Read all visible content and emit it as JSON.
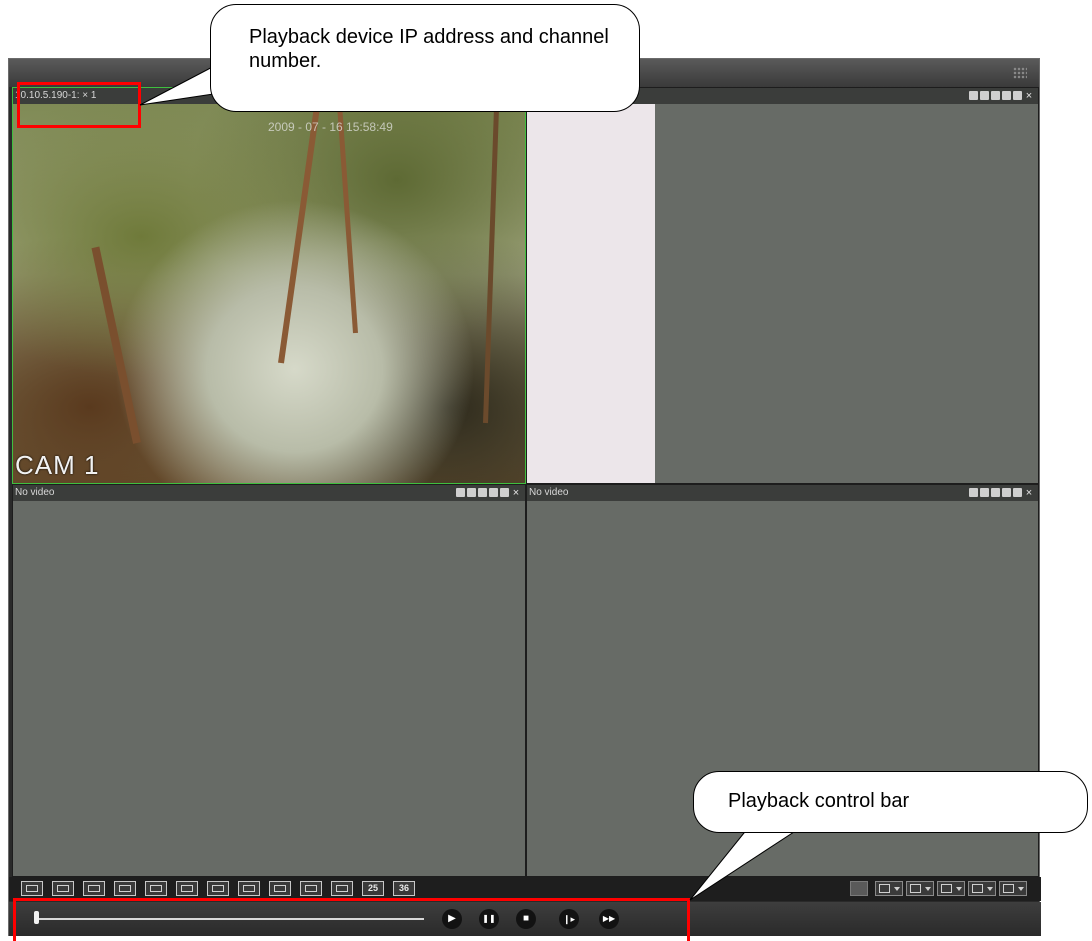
{
  "window": {
    "panes": [
      {
        "title": "10.10.5.190-1: × 1",
        "overlay_label": "CAM 1",
        "timestamp": "2009 - 07 - 16 15:58:49",
        "active": true
      },
      {
        "title": "",
        "overlay_label": "",
        "timestamp": "",
        "active": false
      },
      {
        "title": "No video",
        "overlay_label": "",
        "timestamp": "",
        "active": false
      },
      {
        "title": "No video",
        "overlay_label": "",
        "timestamp": "",
        "active": false
      }
    ],
    "pane_tool_icons": [
      "window-snapshot-icon",
      "record-icon",
      "pip-icon",
      "camera-icon",
      "audio-icon",
      "close-icon"
    ],
    "layout_buttons": [
      {
        "icon": "layout-custom-icon",
        "label": ""
      },
      {
        "icon": "layout-next-icon",
        "label": ""
      },
      {
        "icon": "fullscreen-icon",
        "label": ""
      },
      {
        "icon": "layout-1-icon",
        "label": ""
      },
      {
        "icon": "layout-4-icon",
        "label": ""
      },
      {
        "icon": "layout-6-icon",
        "label": ""
      },
      {
        "icon": "layout-8-icon",
        "label": ""
      },
      {
        "icon": "layout-9-icon",
        "label": ""
      },
      {
        "icon": "layout-13-icon",
        "label": ""
      },
      {
        "icon": "layout-16-icon",
        "label": ""
      },
      {
        "icon": "layout-20-icon",
        "label": ""
      },
      {
        "icon": "layout-25-icon",
        "label": "25"
      },
      {
        "icon": "layout-36-icon",
        "label": "36"
      }
    ],
    "playback": {
      "progress": 0.0,
      "buttons": [
        {
          "icon": "play-icon",
          "glyph": "▶"
        },
        {
          "icon": "pause-icon",
          "glyph": "❚❚"
        },
        {
          "icon": "stop-icon",
          "glyph": "■"
        },
        {
          "icon": "step-forward-icon",
          "glyph": "❙▸"
        },
        {
          "icon": "fast-forward-icon",
          "glyph": "▶▶"
        }
      ]
    }
  },
  "annotations": {
    "device_callout": "Playback device IP address and channel number.",
    "control_callout": "Playback control bar"
  },
  "colors": {
    "highlight": "#ff0000",
    "active_border": "#3fbf3f",
    "pane_bg": "#676b66"
  }
}
